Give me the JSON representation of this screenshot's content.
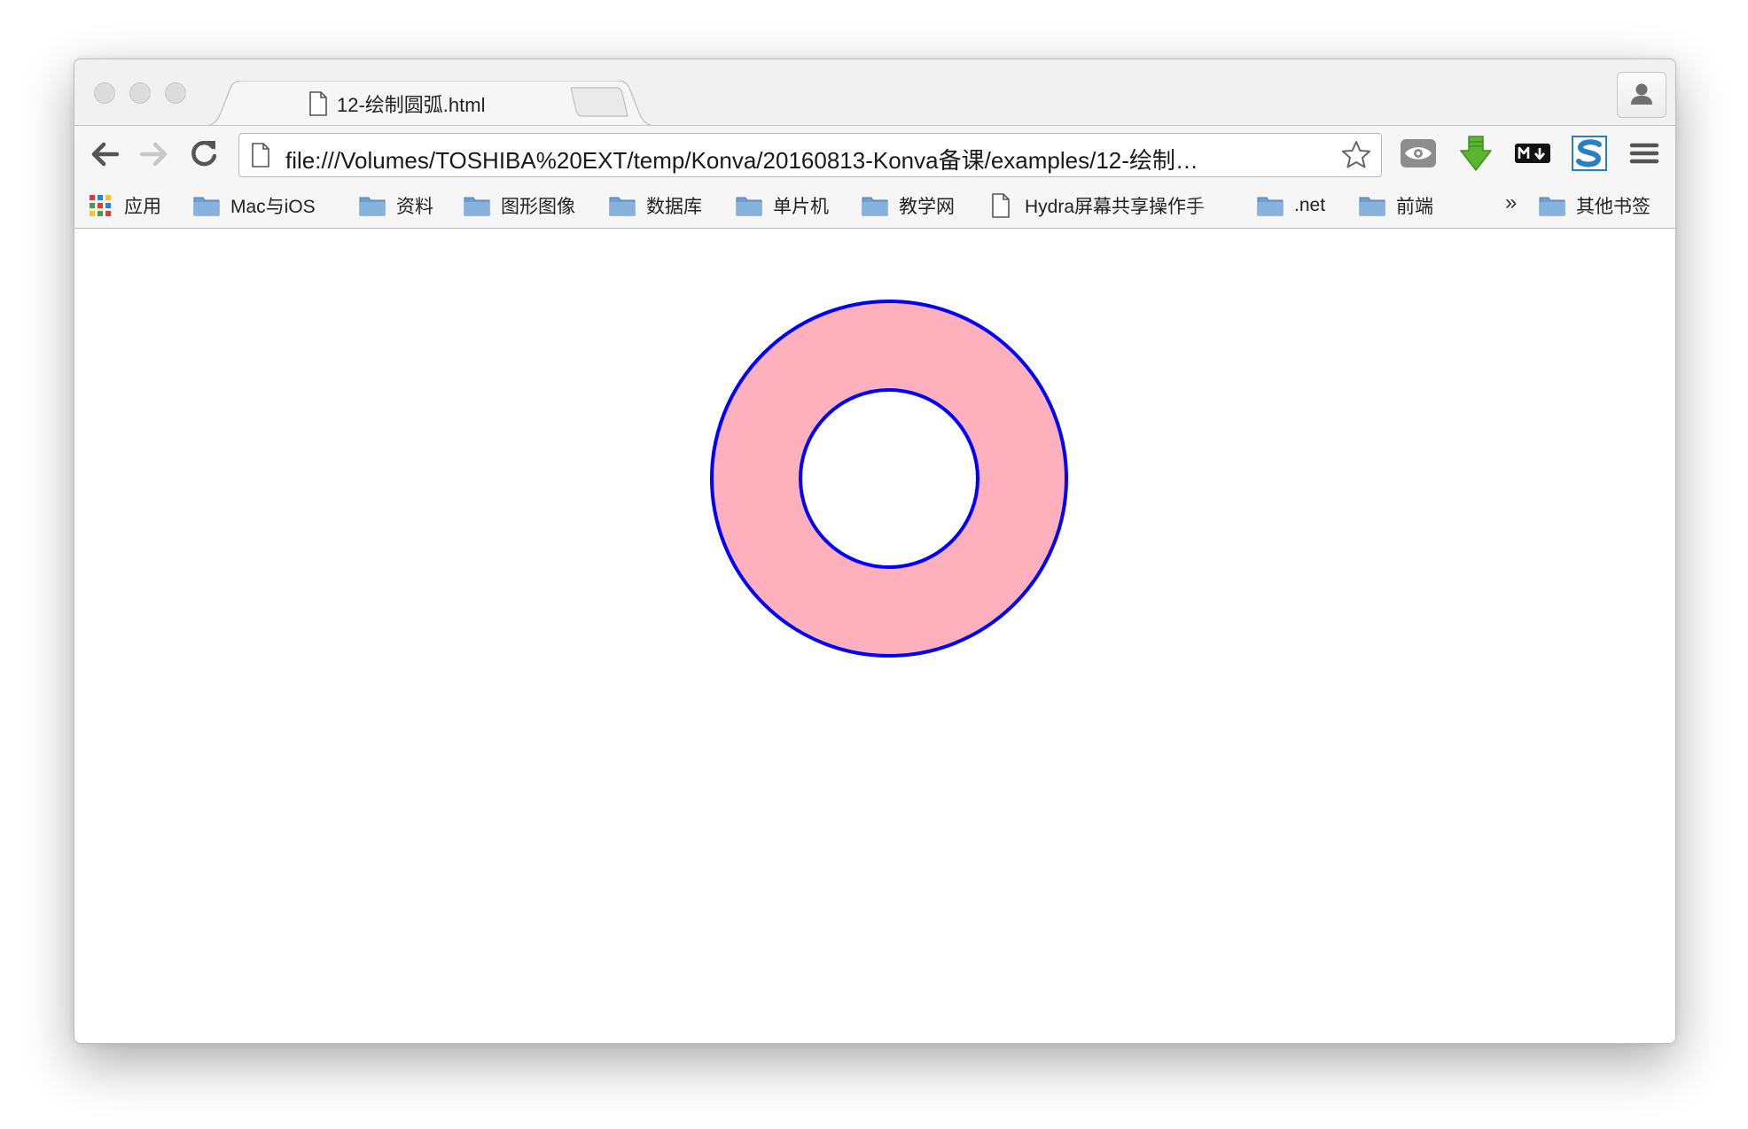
{
  "browser": {
    "tab": {
      "title": "12-绘制圆弧.html",
      "close_glyph": "×"
    },
    "address_bar": {
      "url": "file:///Volumes/TOSHIBA%20EXT/temp/Konva/20160813-Konva备课/examples/12-绘制…"
    },
    "toolbar": {
      "back_icon": "arrow-left-icon",
      "forward_icon": "arrow-right-icon",
      "reload_icon": "reload-icon",
      "bookmark_star_icon": "star-icon",
      "extensions": [
        "eye-icon",
        "download-arrow-icon",
        "markdown-icon",
        "s-logo-icon"
      ],
      "menu_icon": "hamburger-menu-icon"
    },
    "bookmarks": {
      "apps_label": "应用",
      "items": [
        {
          "label": "Mac与iOS",
          "type": "folder"
        },
        {
          "label": "资料",
          "type": "folder"
        },
        {
          "label": "图形图像",
          "type": "folder"
        },
        {
          "label": "数据库",
          "type": "folder"
        },
        {
          "label": "单片机",
          "type": "folder"
        },
        {
          "label": "教学网",
          "type": "folder"
        },
        {
          "label": "Hydra屏幕共享操作手",
          "type": "page"
        },
        {
          "label": ".net",
          "type": "folder"
        },
        {
          "label": "前端",
          "type": "folder"
        }
      ],
      "overflow_glyph": "»",
      "other_bookmarks": "其他书签"
    }
  },
  "canvas": {
    "shape": "ring",
    "fill_color": "#ffb0bd",
    "stroke_color": "#0000ff",
    "background_color": "#ffffff"
  }
}
